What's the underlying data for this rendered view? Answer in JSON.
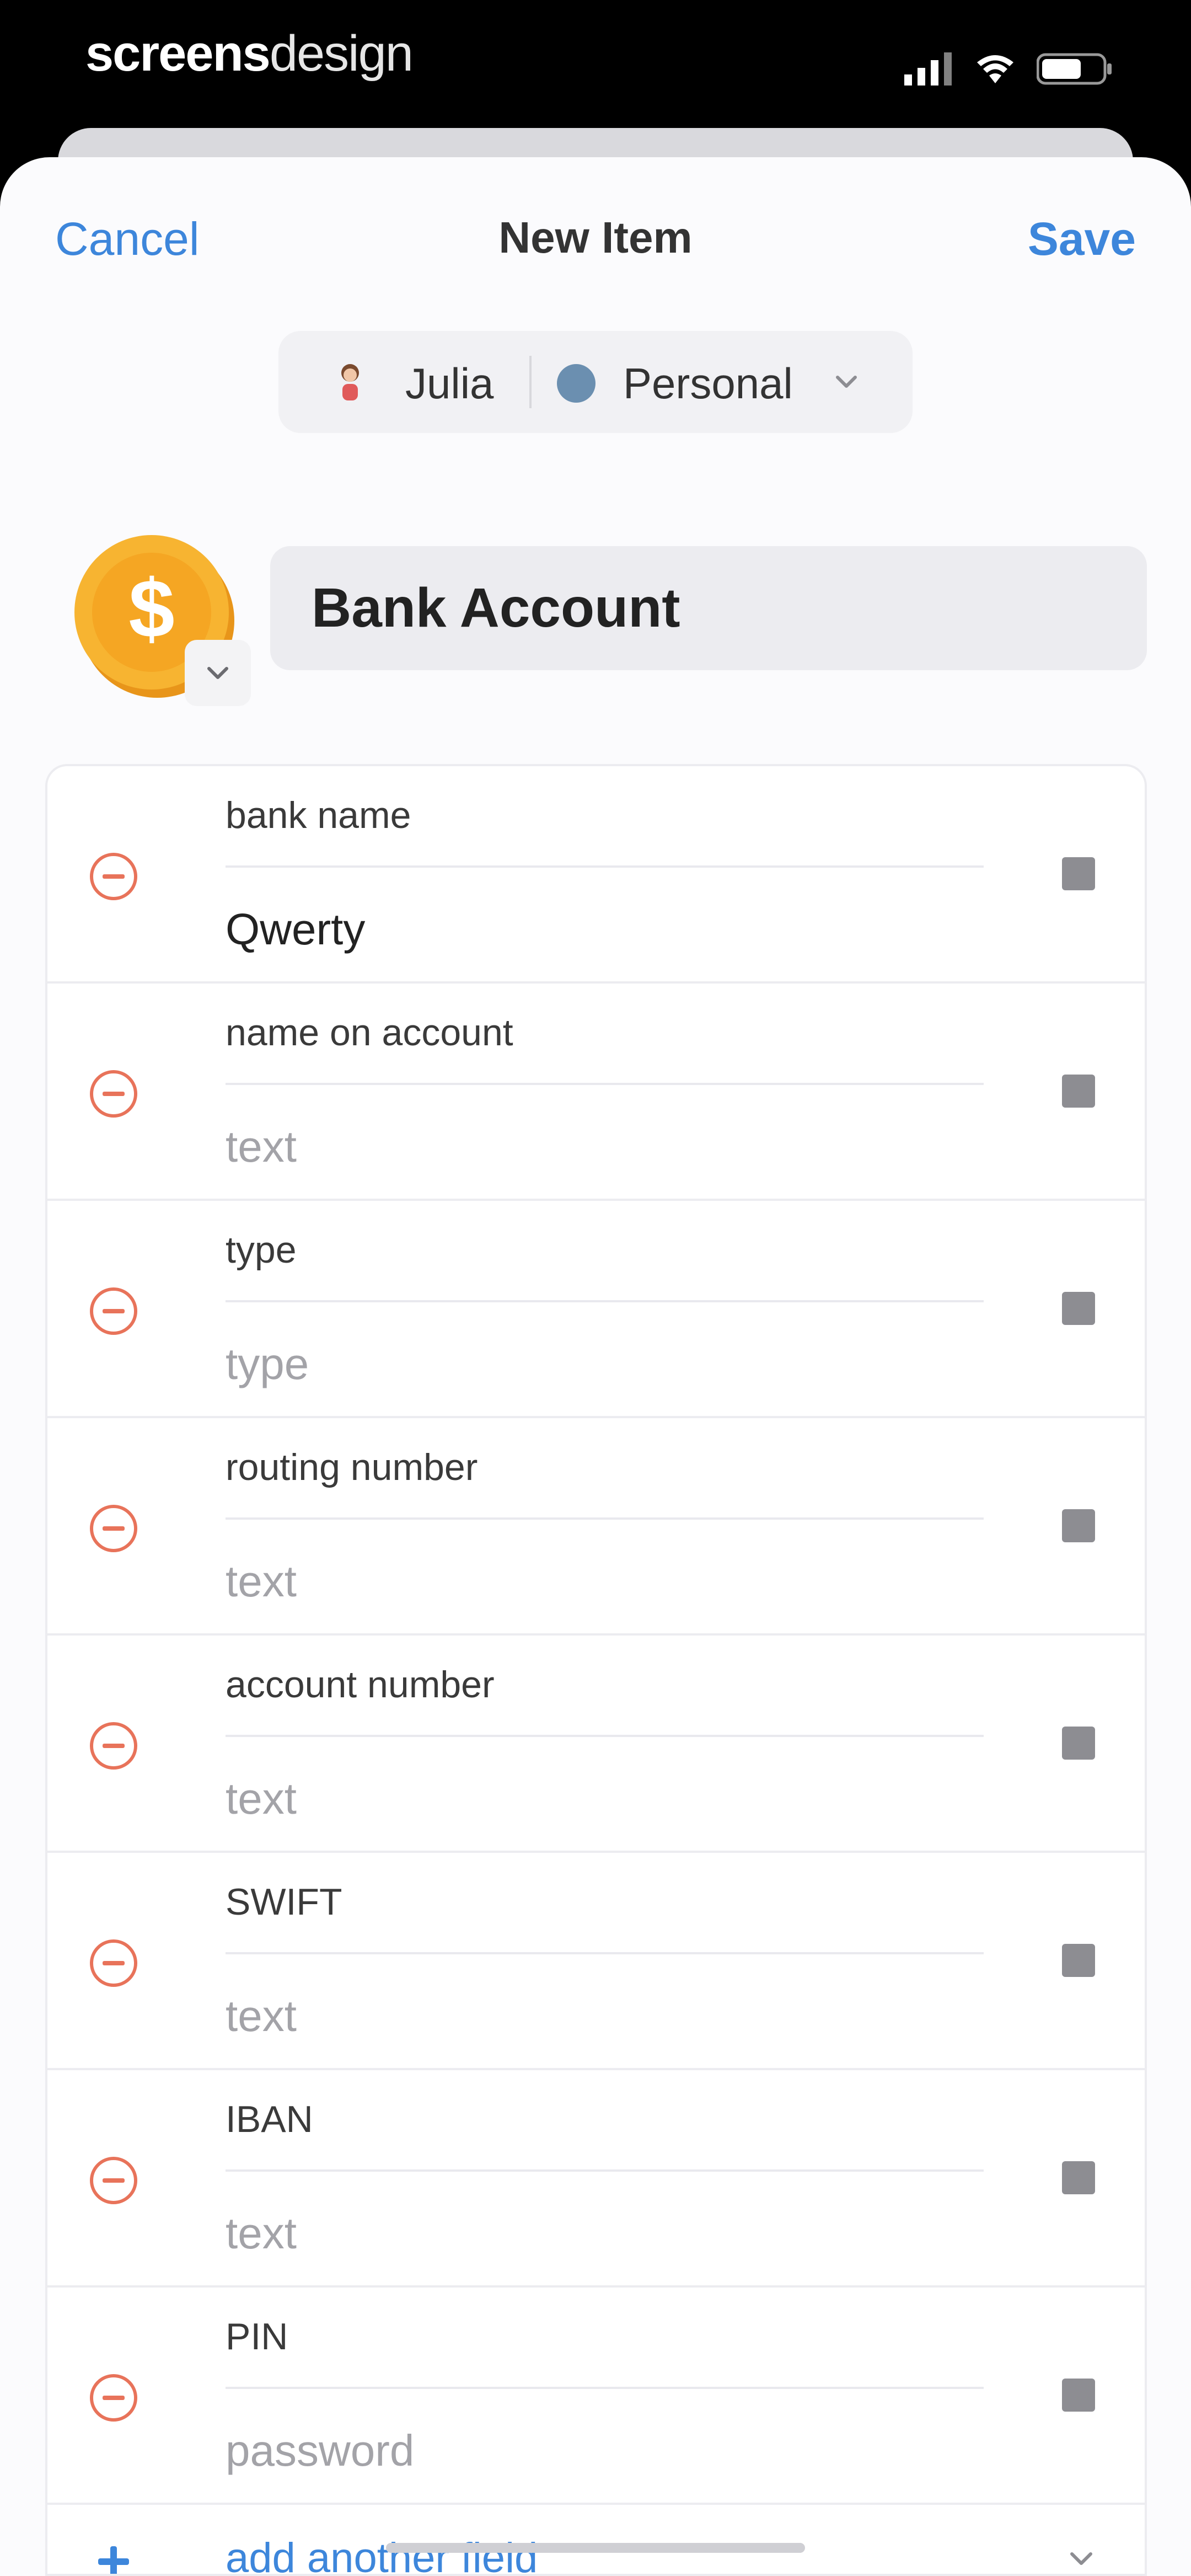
{
  "status_bar": {
    "brand_part1": "screens",
    "brand_part2": "design"
  },
  "nav": {
    "cancel_label": "Cancel",
    "title": "New Item",
    "save_label": "Save"
  },
  "selector": {
    "user": "Julia",
    "vault": "Personal"
  },
  "item": {
    "title": "Bank Account",
    "icon": "dollar-coin-icon"
  },
  "fields": [
    {
      "label": "bank name",
      "value": "Qwerty",
      "placeholder": false
    },
    {
      "label": "name on account",
      "value": "text",
      "placeholder": true
    },
    {
      "label": "type",
      "value": "type",
      "placeholder": true
    },
    {
      "label": "routing number",
      "value": "text",
      "placeholder": true
    },
    {
      "label": "account number",
      "value": "text",
      "placeholder": true
    },
    {
      "label": "SWIFT",
      "value": "text",
      "placeholder": true
    },
    {
      "label": "IBAN",
      "value": "text",
      "placeholder": true
    },
    {
      "label": "PIN",
      "value": "password",
      "placeholder": true
    }
  ],
  "add_field": {
    "label": "add another field"
  },
  "colors": {
    "accent": "#3d86db",
    "remove": "#e8735a",
    "coin": "#f5a623"
  }
}
